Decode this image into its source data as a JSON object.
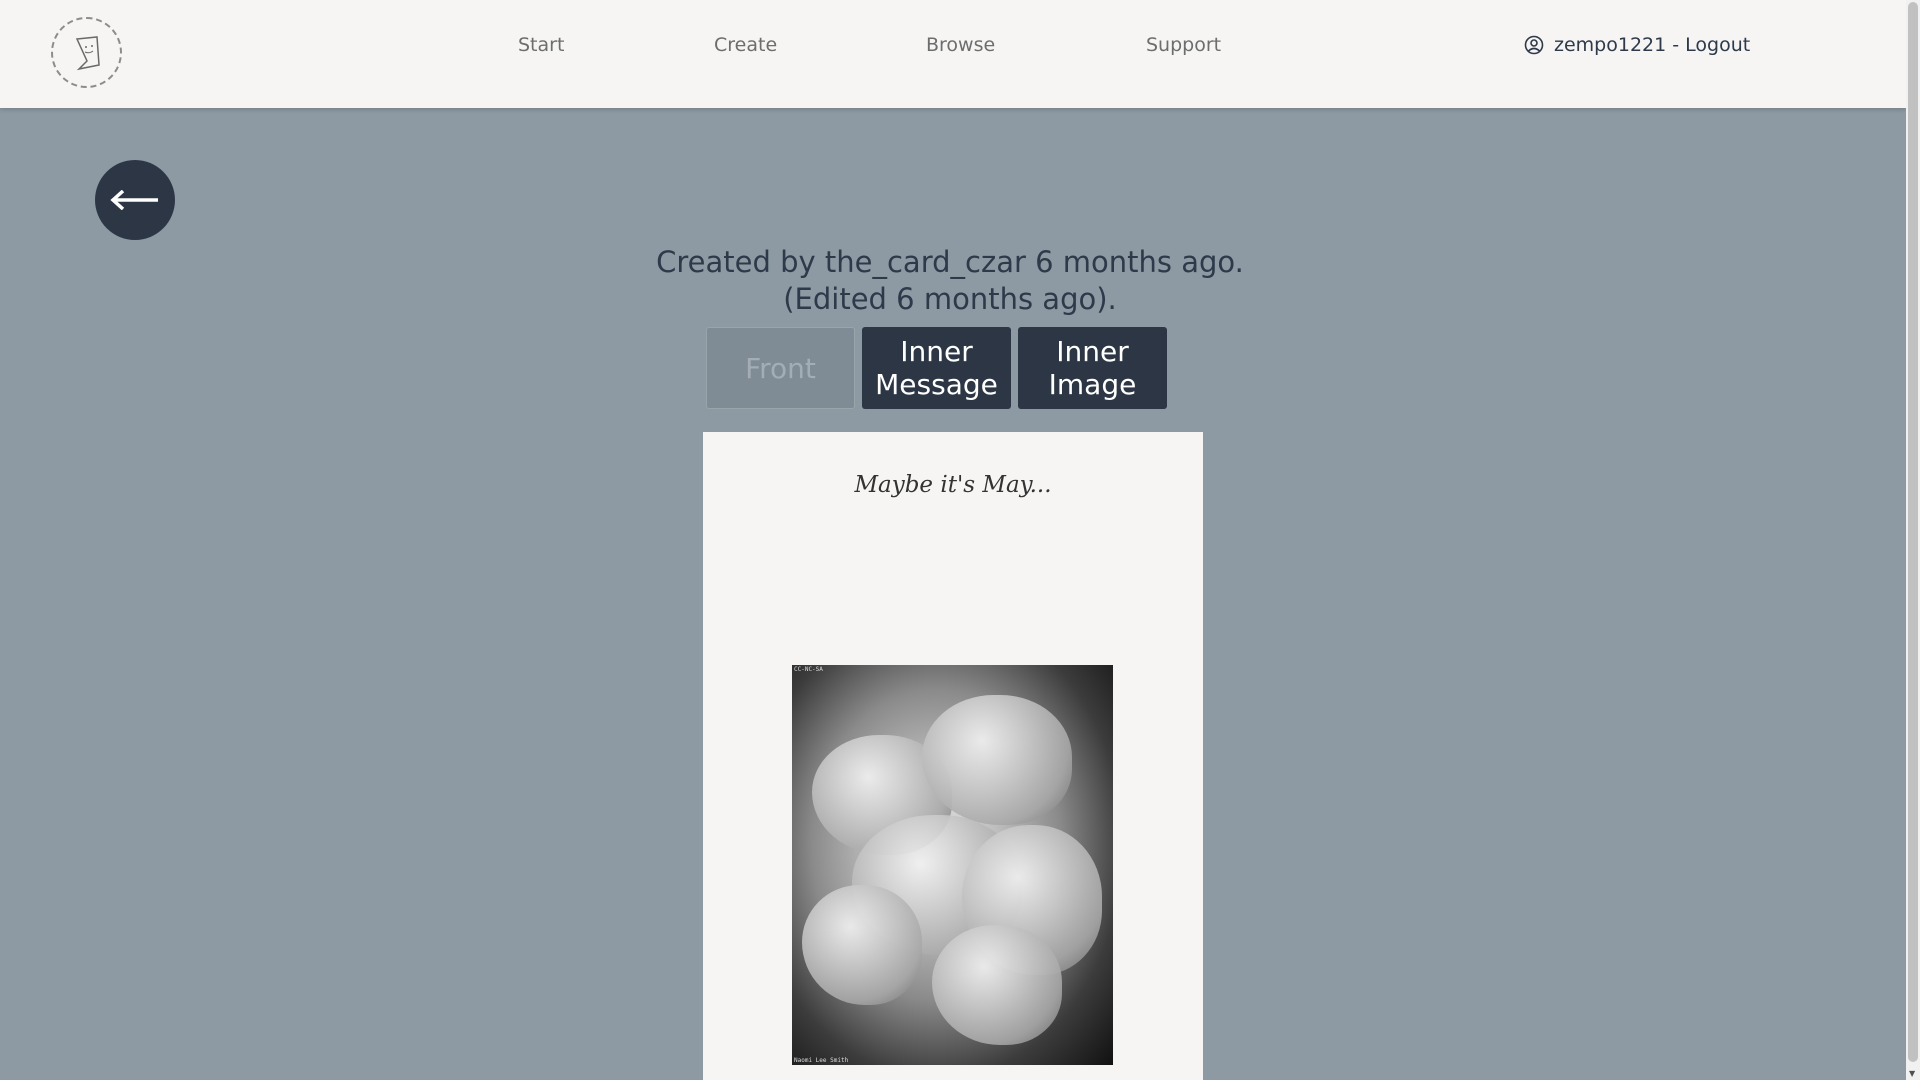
{
  "nav": {
    "links": [
      {
        "label": "Start"
      },
      {
        "label": "Create"
      },
      {
        "label": "Browse"
      },
      {
        "label": "Support"
      }
    ],
    "user_label": "zempo1221 - Logout"
  },
  "meta": {
    "created_line": "Created by the_card_czar 6 months ago.",
    "edited_line": "(Edited 6 months ago)."
  },
  "tabs": [
    {
      "label": "Front",
      "state": "disabled"
    },
    {
      "label": "Inner Message",
      "state": "active"
    },
    {
      "label": "Inner Image",
      "state": "active"
    }
  ],
  "card": {
    "message": "Maybe it's May...",
    "image_license": "CC-NC-SA",
    "image_credit": "Naomi Lee Smith"
  },
  "colors": {
    "background": "#8d9aa3",
    "header": "#f6f5f4",
    "dark": "#2c3644"
  },
  "icons": {
    "back": "arrow-left-icon",
    "user": "user-circle-icon",
    "logo": "card-logo-icon"
  }
}
